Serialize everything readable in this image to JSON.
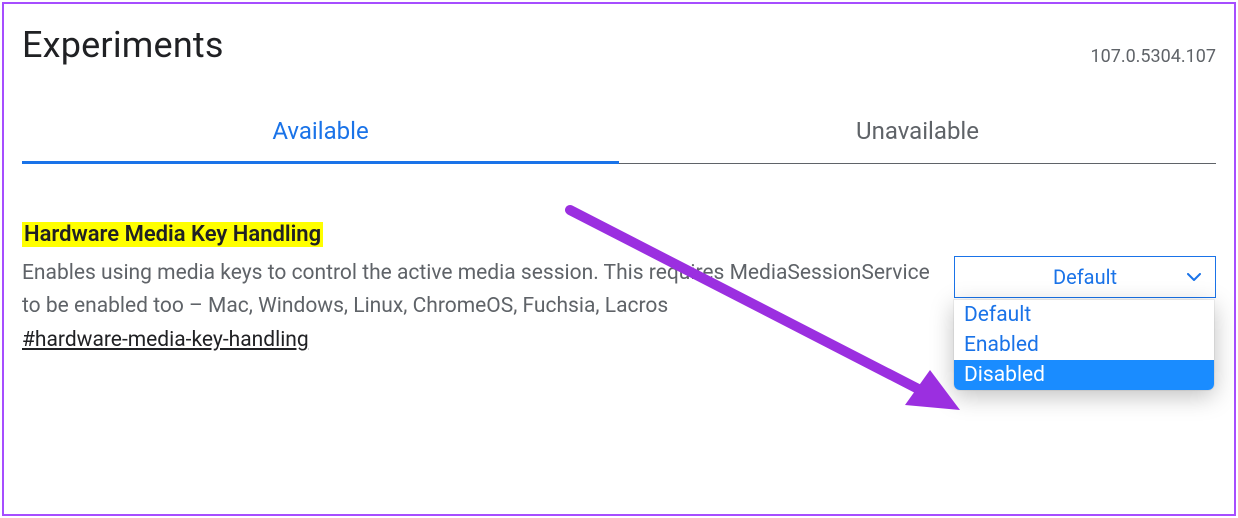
{
  "header": {
    "title": "Experiments",
    "version": "107.0.5304.107"
  },
  "tabs": {
    "available": "Available",
    "unavailable": "Unavailable"
  },
  "flag": {
    "title": "Hardware Media Key Handling",
    "description": "Enables using media keys to control the active media session. This requires MediaSessionService to be enabled too – Mac, Windows, Linux, ChromeOS, Fuchsia, Lacros",
    "anchor": "#hardware-media-key-handling"
  },
  "select": {
    "current": "Default",
    "options": {
      "default": "Default",
      "enabled": "Enabled",
      "disabled": "Disabled"
    },
    "highlighted": "disabled"
  }
}
